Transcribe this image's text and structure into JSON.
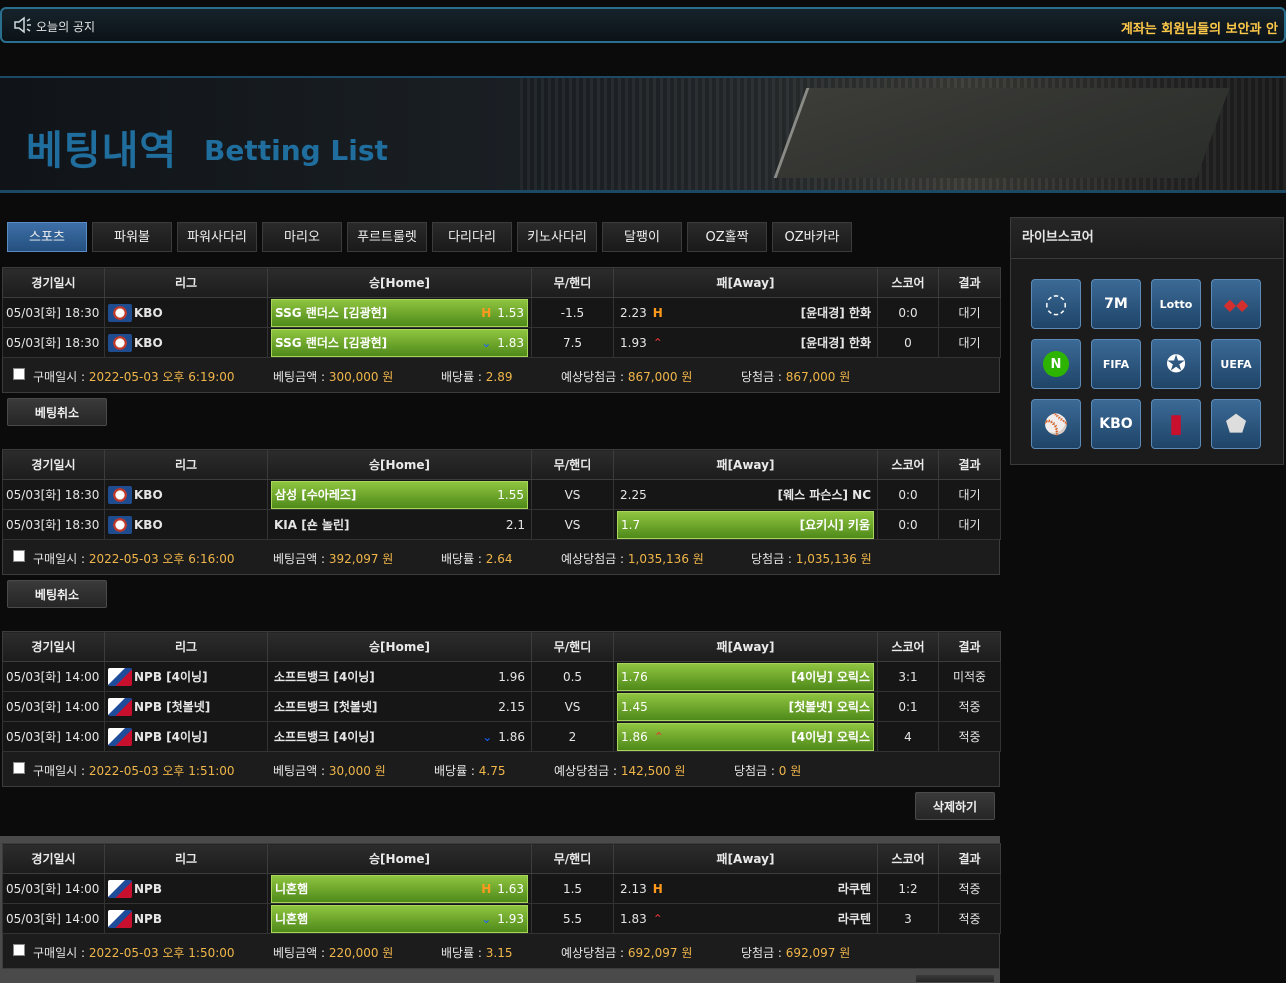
{
  "notice": {
    "label": "오늘의 공지",
    "message": "계좌는 회원님들의 보안과 안"
  },
  "banner": {
    "title_ko": "베팅내역",
    "title_en": "Betting List"
  },
  "tabs": [
    "스포츠",
    "파워볼",
    "파워사다리",
    "마리오",
    "푸르트룰렛",
    "다리다리",
    "키노사다리",
    "달팽이",
    "OZ홀짝",
    "OZ바카라"
  ],
  "active_tab": "스포츠",
  "columns": [
    "경기일시",
    "리그",
    "승[Home]",
    "무/핸디",
    "패[Away]",
    "스코어",
    "결과"
  ],
  "footer_labels": {
    "purchase": "구매일시 : ",
    "amount": "베팅금액 : ",
    "odds": "배당률 : ",
    "expected": "예상당첨금 : ",
    "win": "당첨금 : "
  },
  "bets": [
    {
      "rows": [
        {
          "date": "05/03[화]  18:30",
          "league": "KBO",
          "logo": "kbo-logo",
          "home": "SSG 랜더스 [김광현]",
          "home_mark": "H",
          "home_odds": "1.53",
          "home_sel": true,
          "mid": "-1.5",
          "away_odds": "2.23",
          "away_mark": "H",
          "away": "[윤대경] 한화",
          "away_sel": false,
          "score": "0:0",
          "result": "대기",
          "result_type": "wait"
        },
        {
          "date": "05/03[화]  18:30",
          "league": "KBO",
          "logo": "kbo-logo",
          "home": "SSG 랜더스 [김광현]",
          "home_mark": "down",
          "home_odds": "1.83",
          "home_sel": true,
          "mid": "7.5",
          "away_odds": "1.93",
          "away_mark": "up",
          "away": "[윤대경] 한화",
          "away_sel": false,
          "score": "0",
          "result": "대기",
          "result_type": "wait"
        }
      ],
      "footer": {
        "purchase": "2022-05-03 오후 6:19:00",
        "amount": "300,000 원",
        "odds": "2.89",
        "expected": "867,000 원",
        "win": "867,000 원"
      },
      "button": "베팅취소"
    },
    {
      "rows": [
        {
          "date": "05/03[화]  18:30",
          "league": "KBO",
          "logo": "kbo-logo",
          "home": "삼성 [수아레즈]",
          "home_mark": "",
          "home_odds": "1.55",
          "home_sel": true,
          "mid": "VS",
          "away_odds": "2.25",
          "away_mark": "",
          "away": "[웨스 파슨스] NC",
          "away_sel": false,
          "score": "0:0",
          "result": "대기",
          "result_type": "wait"
        },
        {
          "date": "05/03[화]  18:30",
          "league": "KBO",
          "logo": "kbo-logo",
          "home": "KIA [숀 놀린]",
          "home_mark": "",
          "home_odds": "2.1",
          "home_sel": false,
          "mid": "VS",
          "away_odds": "1.7",
          "away_mark": "",
          "away": "[요키시] 키움",
          "away_sel": true,
          "score": "0:0",
          "result": "대기",
          "result_type": "wait"
        }
      ],
      "footer": {
        "purchase": "2022-05-03 오후 6:16:00",
        "amount": "392,097 원",
        "odds": "2.64",
        "expected": "1,035,136 원",
        "win": "1,035,136 원"
      },
      "button": "베팅취소"
    },
    {
      "rows": [
        {
          "date": "05/03[화]  14:00",
          "league": "NPB [4이닝]",
          "logo": "npb-logo",
          "home": "소프트뱅크 [4이닝]",
          "home_mark": "",
          "home_odds": "1.96",
          "home_sel": false,
          "mid": "0.5",
          "away_odds": "1.76",
          "away_mark": "",
          "away": "[4이닝] 오릭스",
          "away_sel": true,
          "score": "3:1",
          "result": "미적중",
          "result_type": "miss"
        },
        {
          "date": "05/03[화]  14:00",
          "league": "NPB [첫볼넷]",
          "logo": "npb-logo",
          "home": "소프트뱅크 [첫볼넷]",
          "home_mark": "",
          "home_odds": "2.15",
          "home_sel": false,
          "mid": "VS",
          "away_odds": "1.45",
          "away_mark": "",
          "away": "[첫볼넷] 오릭스",
          "away_sel": true,
          "score": "0:1",
          "result": "적중",
          "result_type": "hit"
        },
        {
          "date": "05/03[화]  14:00",
          "league": "NPB [4이닝]",
          "logo": "npb-logo",
          "home": "소프트뱅크 [4이닝]",
          "home_mark": "down",
          "home_odds": "1.86",
          "home_sel": false,
          "mid": "2",
          "away_odds": "1.86",
          "away_mark": "up",
          "away": "[4이닝] 오릭스",
          "away_sel": true,
          "score": "4",
          "result": "적중",
          "result_type": "hit"
        }
      ],
      "footer": {
        "purchase": "2022-05-03 오후 1:51:00",
        "amount": "30,000 원",
        "odds": "4.75",
        "expected": "142,500 원",
        "win": "0 원"
      },
      "button": "삭제하기"
    },
    {
      "rows": [
        {
          "date": "05/03[화]  14:00",
          "league": "NPB",
          "logo": "npb-logo",
          "home": "니혼햄",
          "home_mark": "H",
          "home_odds": "1.63",
          "home_sel": true,
          "mid": "1.5",
          "away_odds": "2.13",
          "away_mark": "H",
          "away": "라쿠텐",
          "away_sel": false,
          "score": "1:2",
          "result": "적중",
          "result_type": "hit"
        },
        {
          "date": "05/03[화]  14:00",
          "league": "NPB",
          "logo": "npb-logo",
          "home": "니혼햄",
          "home_mark": "down",
          "home_odds": "1.93",
          "home_sel": true,
          "mid": "5.5",
          "away_odds": "1.83",
          "away_mark": "up",
          "away": "라쿠텐",
          "away_sel": false,
          "score": "3",
          "result": "적중",
          "result_type": "hit"
        }
      ],
      "footer": {
        "purchase": "2022-05-03 오후 1:50:00",
        "amount": "220,000 원",
        "odds": "3.15",
        "expected": "692,097 원",
        "win": "692,097 원"
      },
      "button": ""
    }
  ],
  "live": {
    "title": "라이브스코어",
    "items": [
      {
        "icon": "livescore-ring-icon",
        "text": ""
      },
      {
        "icon": "7m-logo-icon",
        "text": "7M"
      },
      {
        "icon": "lotto-logo-icon",
        "text": "Lotto"
      },
      {
        "icon": "red-diamonds-icon",
        "text": ""
      },
      {
        "icon": "naver-n-icon",
        "text": "N"
      },
      {
        "icon": "fifa-logo-icon",
        "text": "FIFA"
      },
      {
        "icon": "champions-league-icon",
        "text": ""
      },
      {
        "icon": "uefa-logo-icon",
        "text": "UEFA"
      },
      {
        "icon": "mlb-logo-icon",
        "text": ""
      },
      {
        "icon": "kbo-logo-icon",
        "text": "KBO"
      },
      {
        "icon": "nba-logo-icon",
        "text": ""
      },
      {
        "icon": "nhl-logo-icon",
        "text": ""
      }
    ]
  }
}
